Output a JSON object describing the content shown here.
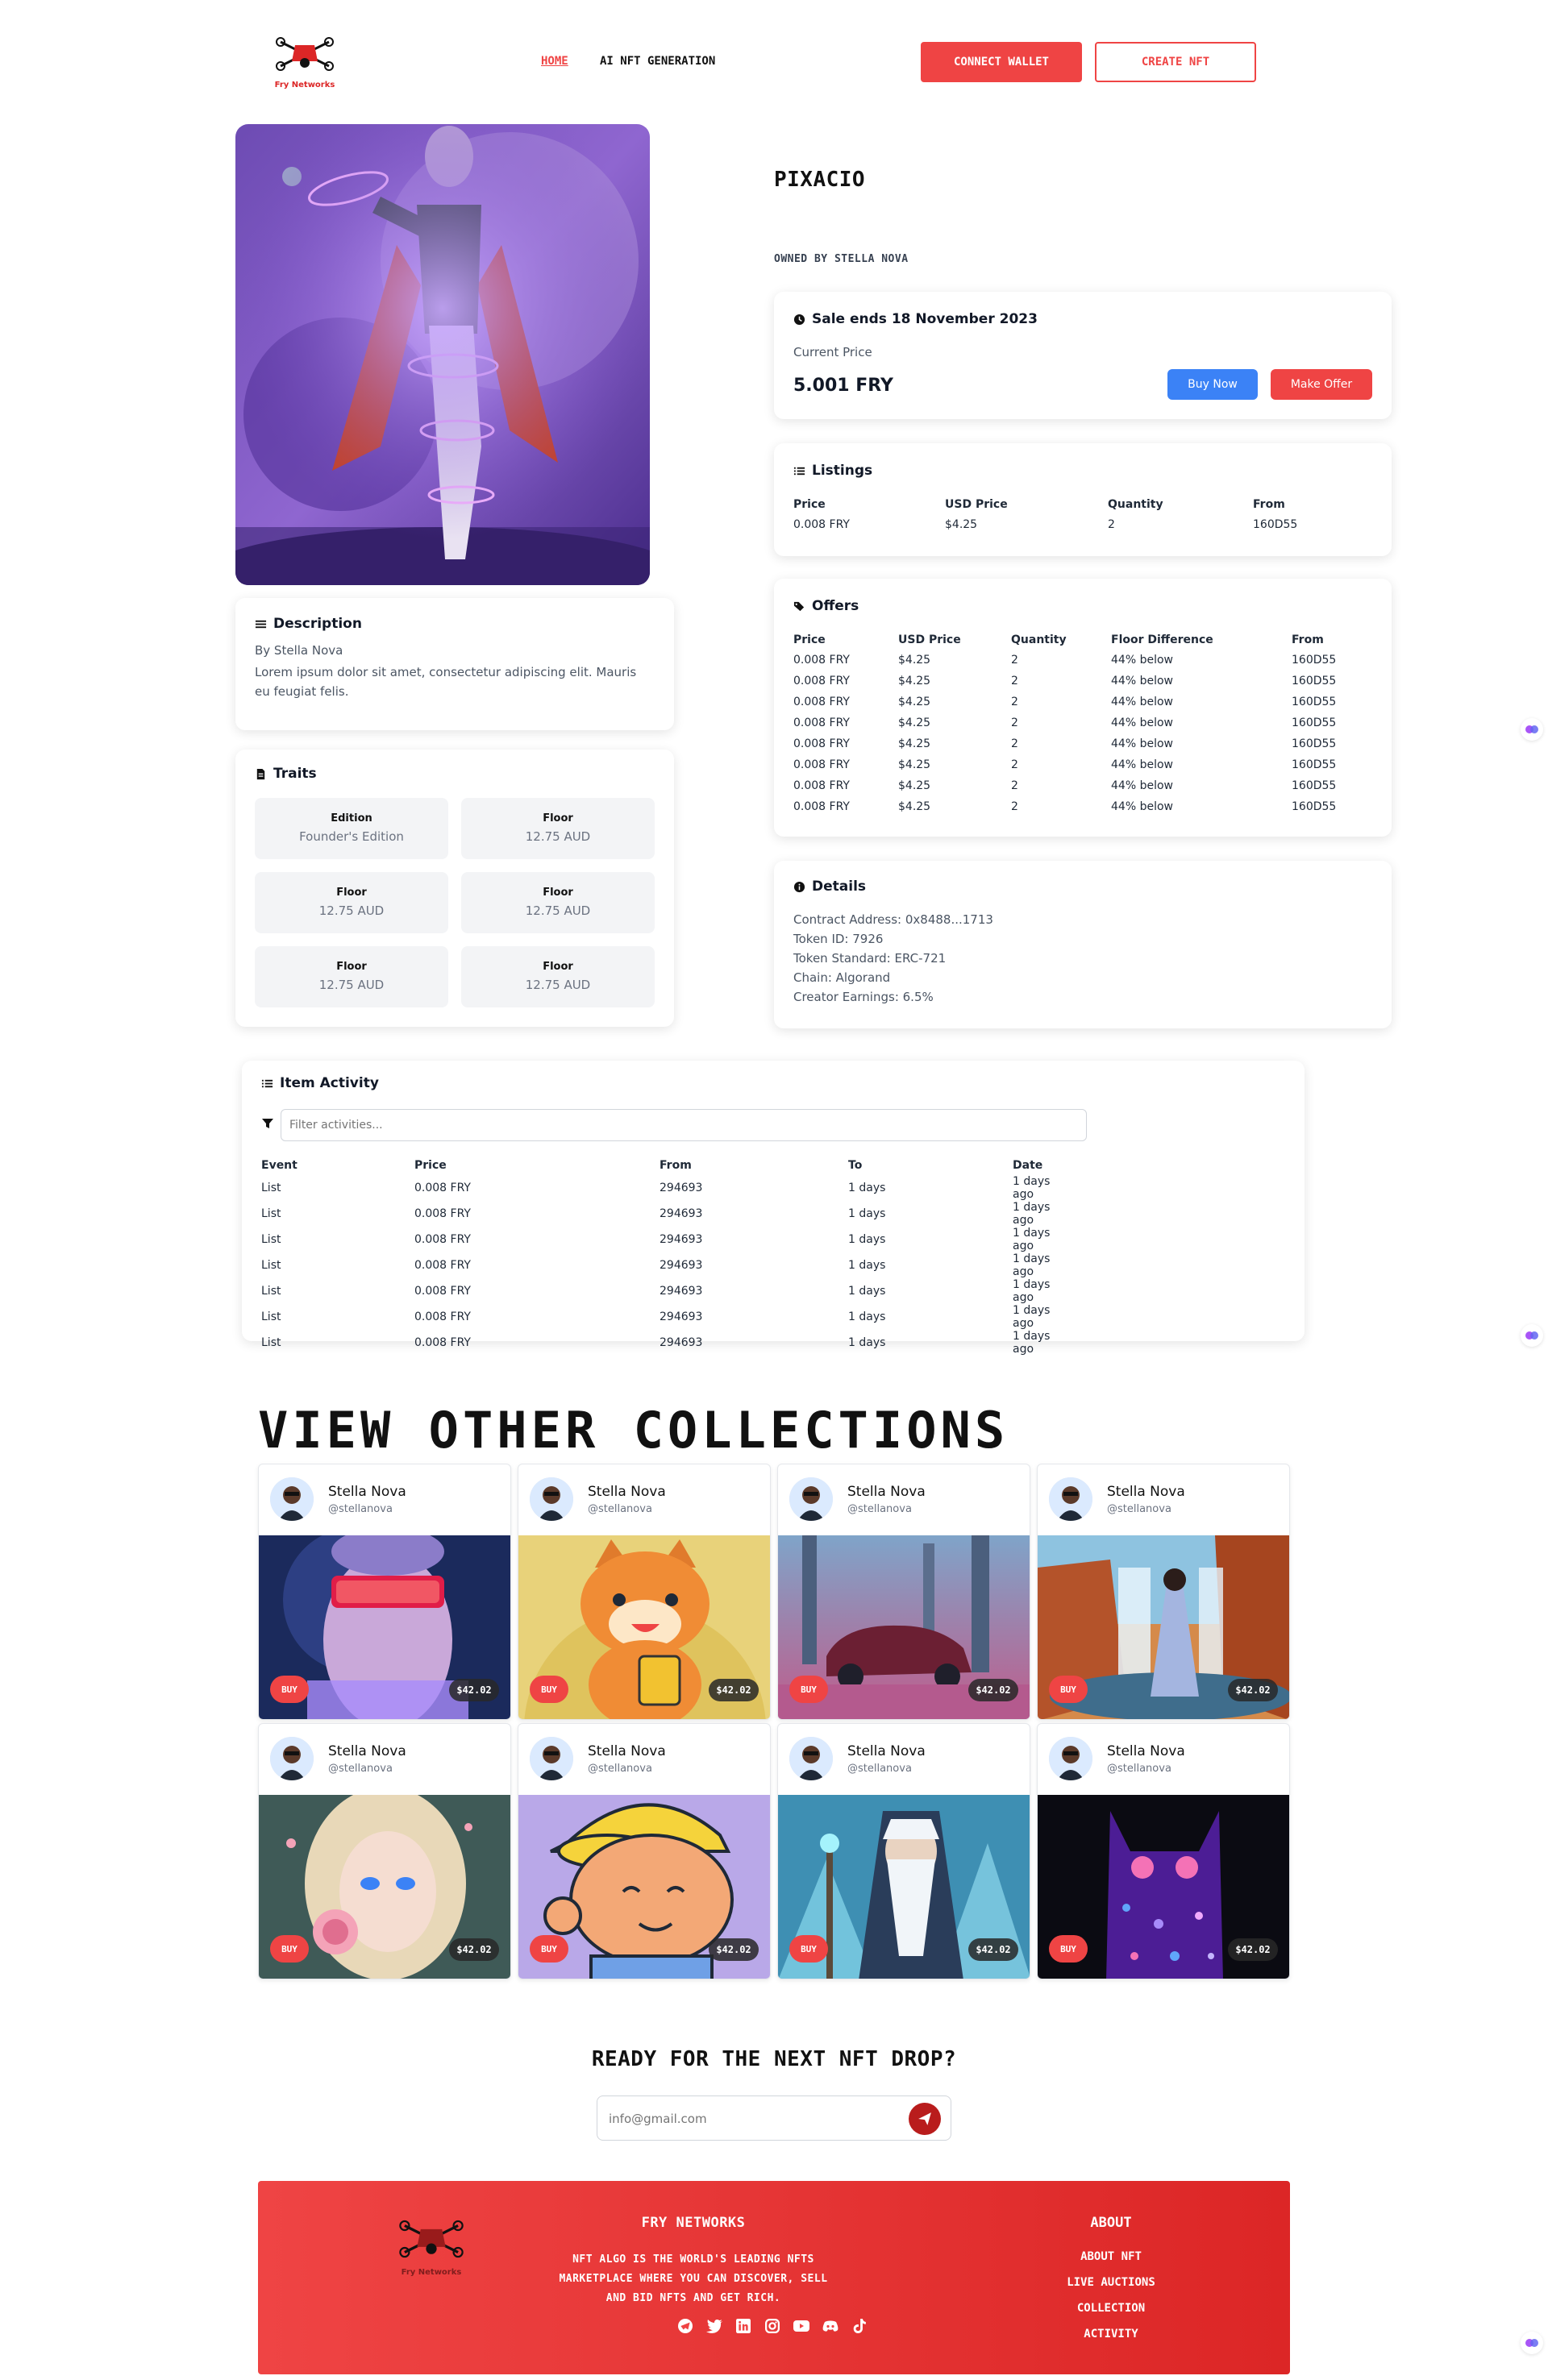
{
  "header": {
    "logo_text": "Fry Networks",
    "nav": [
      {
        "label": "HOME",
        "active": true
      },
      {
        "label": "AI NFT GENERATION",
        "active": false
      }
    ],
    "connect_wallet": "CONNECT WALLET",
    "create_nft": "CREATE NFT"
  },
  "item": {
    "title": "PIXACIO",
    "owner": "OWNED BY STELLA NOVA"
  },
  "sale": {
    "ends": "Sale ends 18 November 2023",
    "current_price_label": "Current Price",
    "price": "5.001 FRY",
    "buy_now": "Buy Now",
    "make_offer": "Make Offer"
  },
  "listings": {
    "title": "Listings",
    "headers": [
      "Price",
      "USD Price",
      "Quantity",
      "From"
    ],
    "rows": [
      [
        "0.008 FRY",
        "$4.25",
        "2",
        "160D55"
      ]
    ]
  },
  "offers": {
    "title": "Offers",
    "headers": [
      "Price",
      "USD Price",
      "Quantity",
      "Floor Difference",
      "From"
    ],
    "rows": [
      [
        "0.008 FRY",
        "$4.25",
        "2",
        "44% below",
        "160D55"
      ],
      [
        "0.008 FRY",
        "$4.25",
        "2",
        "44% below",
        "160D55"
      ],
      [
        "0.008 FRY",
        "$4.25",
        "2",
        "44% below",
        "160D55"
      ],
      [
        "0.008 FRY",
        "$4.25",
        "2",
        "44% below",
        "160D55"
      ],
      [
        "0.008 FRY",
        "$4.25",
        "2",
        "44% below",
        "160D55"
      ],
      [
        "0.008 FRY",
        "$4.25",
        "2",
        "44% below",
        "160D55"
      ],
      [
        "0.008 FRY",
        "$4.25",
        "2",
        "44% below",
        "160D55"
      ],
      [
        "0.008 FRY",
        "$4.25",
        "2",
        "44% below",
        "160D55"
      ]
    ]
  },
  "description": {
    "title": "Description",
    "by": "By Stella Nova",
    "body": "Lorem ipsum dolor sit amet, consectetur adipiscing elit. Mauris eu feugiat felis."
  },
  "traits": {
    "title": "Traits",
    "items": [
      {
        "name": "Edition",
        "value": "Founder's Edition"
      },
      {
        "name": "Floor",
        "value": "12.75 AUD"
      },
      {
        "name": "Floor",
        "value": "12.75 AUD"
      },
      {
        "name": "Floor",
        "value": "12.75 AUD"
      },
      {
        "name": "Floor",
        "value": "12.75 AUD"
      },
      {
        "name": "Floor",
        "value": "12.75 AUD"
      }
    ]
  },
  "details": {
    "title": "Details",
    "lines": [
      "Contract Address: 0x8488...1713",
      "Token ID: 7926",
      "Token Standard: ERC-721",
      "Chain: Algorand",
      "Creator Earnings: 6.5%"
    ]
  },
  "activity": {
    "title": "Item Activity",
    "filter_placeholder": "Filter activities...",
    "headers": [
      "Event",
      "Price",
      "From",
      "To",
      "Date"
    ],
    "rows": [
      [
        "List",
        "0.008 FRY",
        "294693",
        "1 days",
        "1 days ago"
      ],
      [
        "List",
        "0.008 FRY",
        "294693",
        "1 days",
        "1 days ago"
      ],
      [
        "List",
        "0.008 FRY",
        "294693",
        "1 days",
        "1 days ago"
      ],
      [
        "List",
        "0.008 FRY",
        "294693",
        "1 days",
        "1 days ago"
      ],
      [
        "List",
        "0.008 FRY",
        "294693",
        "1 days",
        "1 days ago"
      ],
      [
        "List",
        "0.008 FRY",
        "294693",
        "1 days",
        "1 days ago"
      ],
      [
        "List",
        "0.008 FRY",
        "294693",
        "1 days",
        "1 days ago"
      ]
    ]
  },
  "collections": {
    "title": "VIEW OTHER COLLECTIONS",
    "cards": [
      {
        "name": "Stella Nova",
        "handle": "@stellanova",
        "buy": "BUY",
        "price": "$42.02",
        "art": "statue-vr"
      },
      {
        "name": "Stella Nova",
        "handle": "@stellanova",
        "buy": "BUY",
        "price": "$42.02",
        "art": "cartoon-cat"
      },
      {
        "name": "Stella Nova",
        "handle": "@stellanova",
        "buy": "BUY",
        "price": "$42.02",
        "art": "car-forest"
      },
      {
        "name": "Stella Nova",
        "handle": "@stellanova",
        "buy": "BUY",
        "price": "$42.02",
        "art": "waterfall-girl"
      },
      {
        "name": "Stella Nova",
        "handle": "@stellanova",
        "buy": "BUY",
        "price": "$42.02",
        "art": "anime-rose"
      },
      {
        "name": "Stella Nova",
        "handle": "@stellanova",
        "buy": "BUY",
        "price": "$42.02",
        "art": "cartoon-cap"
      },
      {
        "name": "Stella Nova",
        "handle": "@stellanova",
        "buy": "BUY",
        "price": "$42.02",
        "art": "wizard"
      },
      {
        "name": "Stella Nova",
        "handle": "@stellanova",
        "buy": "BUY",
        "price": "$42.02",
        "art": "glitter-cat"
      }
    ]
  },
  "newsletter": {
    "title": "READY FOR THE NEXT NFT DROP?",
    "placeholder": "info@gmail.com"
  },
  "footer": {
    "logo_text": "Fry Networks",
    "brand": "FRY NETWORKS",
    "tagline": "NFT ALGO IS THE WORLD'S LEADING NFTS MARKETPLACE WHERE YOU CAN DISCOVER, SELL AND BID NFTS AND GET RICH.",
    "links_title": "ABOUT",
    "links": [
      "ABOUT NFT",
      "LIVE AUCTIONS",
      "COLLECTION",
      "ACTIVITY"
    ],
    "socials": [
      "telegram-icon",
      "twitter-icon",
      "linkedin-icon",
      "instagram-icon",
      "youtube-icon",
      "discord-icon",
      "tiktok-icon"
    ],
    "color_start": "#ef4444",
    "color_end": "#dc2626"
  },
  "colors": {
    "accent": "#ef4444",
    "blue": "#3b82f6"
  }
}
